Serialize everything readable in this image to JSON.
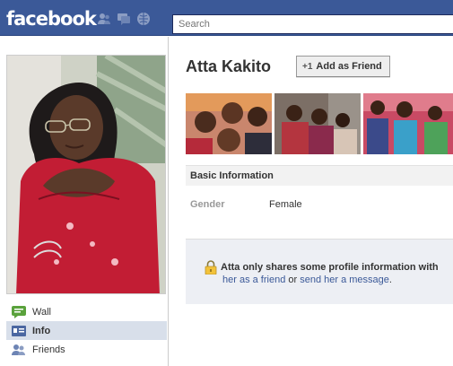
{
  "header": {
    "logo": "facebook",
    "search_placeholder": "Search",
    "jewels": [
      "friend-requests-icon",
      "messages-icon",
      "notifications-icon"
    ]
  },
  "nav": {
    "items": [
      {
        "label": "Wall",
        "icon": "wall-icon",
        "active": false
      },
      {
        "label": "Info",
        "icon": "info-icon",
        "active": true
      },
      {
        "label": "Friends",
        "icon": "friends-icon",
        "active": false
      }
    ]
  },
  "profile": {
    "name": "Atta Kakito",
    "add_friend_label": "Add as Friend"
  },
  "basic_info": {
    "title": "Basic Information",
    "gender_label": "Gender",
    "gender_value": "Female"
  },
  "notice": {
    "line1": "Atta only shares some profile information with",
    "line2_link1": "her as a friend",
    "line2_or": " or ",
    "line2_link2": "send her a message",
    "line2_end": "."
  },
  "colors": {
    "brand_blue": "#3b5998",
    "nav_active_bg": "#d8dfea",
    "notice_bg": "#edeff4"
  }
}
